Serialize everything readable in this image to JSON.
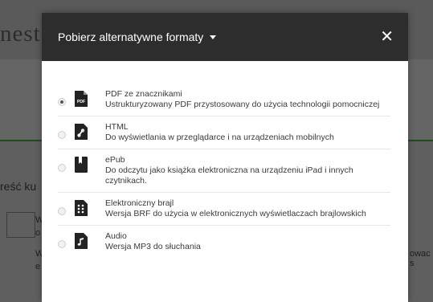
{
  "background": {
    "title_fragment": "nest",
    "heading_fragment": "reść ku",
    "row_fragments": [
      "W",
      "o",
      "W",
      "e"
    ],
    "right_fragment": "owac s"
  },
  "modal": {
    "title": "Pobierz alternatywne formaty",
    "close_label": "✕",
    "options": [
      {
        "name": "PDF ze znacznikami",
        "description": "Ustrukturyzowany PDF przystosowany do użycia technologii pomocniczej",
        "icon": "pdf-file-icon",
        "icon_text": "PDF",
        "selected": true
      },
      {
        "name": "HTML",
        "description": "Do wyświetlania w przeglądarce i na urządzeniach mobilnych",
        "icon": "html-file-icon",
        "selected": false
      },
      {
        "name": "ePub",
        "description": "Do odczytu jako książka elektroniczna na urządzeniu iPad i innych czytnikach.",
        "icon": "epub-book-icon",
        "selected": false
      },
      {
        "name": "Elektroniczny brajl",
        "description": "Wersja BRF do użycia w elektronicznych wyświetlaczach brajlowskich",
        "icon": "braille-file-icon",
        "selected": false
      },
      {
        "name": "Audio",
        "description": "Wersja MP3 do słuchania",
        "icon": "audio-file-icon",
        "selected": false
      }
    ]
  }
}
